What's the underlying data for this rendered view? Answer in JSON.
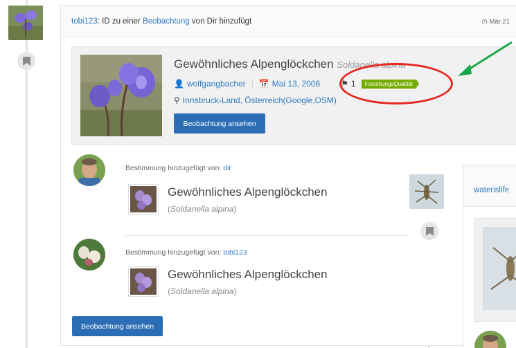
{
  "feed_item": {
    "header": {
      "user": "tobi123",
      "action_text": ": ID zu einer ",
      "target_link": "Beobachtung",
      "action_suffix": " von Dir hinzufügt",
      "date": "Mär 21"
    },
    "observation": {
      "common_name": "Gewöhnliches Alpenglöckchen",
      "scientific_name": "Soldanella alpina",
      "observer": "wolfgangbacher",
      "date": "Mai 13, 2006",
      "id_count": "1",
      "quality_badge": "ForschungsQualität",
      "location": "Innsbruck-Land, Österreich",
      "loc_open": " (",
      "google_link": "Google",
      "loc_comma": ", ",
      "osm_link": "OSM",
      "loc_close": ")",
      "view_button": "Beobachtung ansehen"
    },
    "identifications": [
      {
        "label": "Bestimmung hinzugefügt von: ",
        "user": "dir",
        "common_name": "Gewöhnliches Alpenglöckchen",
        "sci_open": "(",
        "scientific_name": "Soldanella alpina",
        "sci_close": ")"
      },
      {
        "label": "Bestimmung hinzugefügt von: ",
        "user": "tobi123",
        "common_name": "Gewöhnliches Alpenglöckchen",
        "sci_open": "(",
        "scientific_name": "Soldanella alpina",
        "sci_close": ")"
      }
    ],
    "bottom_button": "Beobachtung ansehen"
  },
  "next_item": {
    "user": "waterislife"
  },
  "annotation": {
    "ellipse_color": "#e8251f",
    "arrow_color": "#1aa64a"
  },
  "colors": {
    "link": "#2f7bbf",
    "button": "#2b6eb5",
    "quality_badge": "#74ac00"
  }
}
